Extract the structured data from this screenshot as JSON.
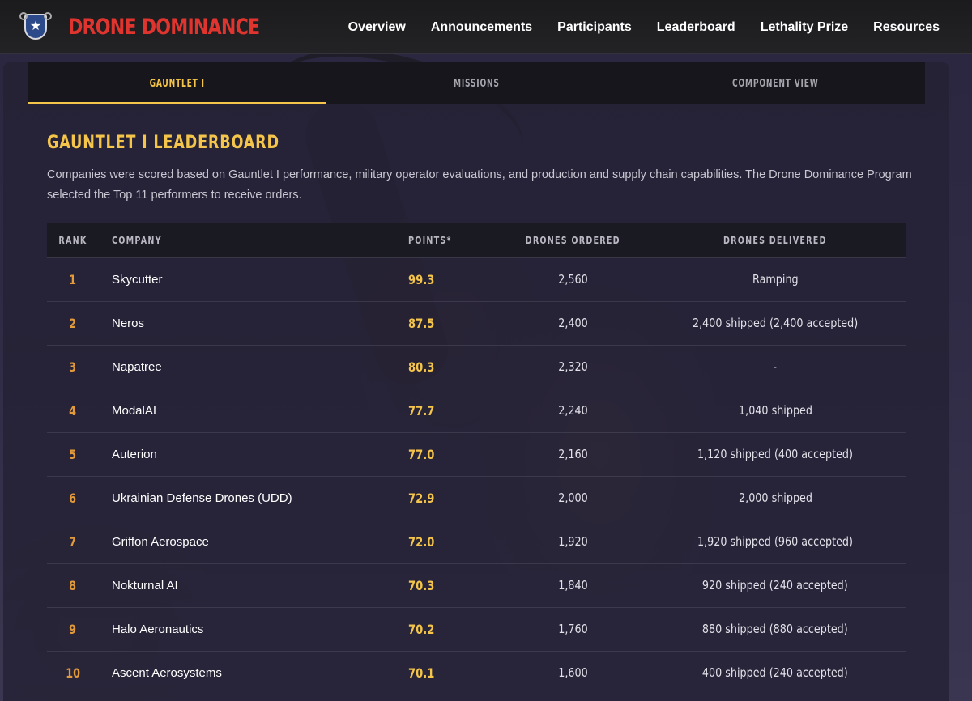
{
  "brand": {
    "name": "DRONE DOMINANCE",
    "logo_icon": "shield-star-icon"
  },
  "nav": [
    {
      "label": "Overview"
    },
    {
      "label": "Announcements"
    },
    {
      "label": "Participants"
    },
    {
      "label": "Leaderboard"
    },
    {
      "label": "Lethality Prize"
    },
    {
      "label": "Resources"
    }
  ],
  "tabs": [
    {
      "label": "GAUNTLET I",
      "active": true
    },
    {
      "label": "MISSIONS",
      "active": false
    },
    {
      "label": "COMPONENT VIEW",
      "active": false
    }
  ],
  "leaderboard": {
    "title": "GAUNTLET I LEADERBOARD",
    "description": "Companies were scored based on Gauntlet I performance, military operator evaluations, and production and supply chain capabilities. The Drone Dominance Program selected the Top 11 performers to receive orders.",
    "columns": {
      "rank": "RANK",
      "company": "COMPANY",
      "points": "POINTS*",
      "ordered": "DRONES ORDERED",
      "delivered": "DRONES DELIVERED"
    },
    "rows": [
      {
        "rank": "1",
        "company": "Skycutter",
        "points": "99.3",
        "ordered": "2,560",
        "delivered": "Ramping"
      },
      {
        "rank": "2",
        "company": "Neros",
        "points": "87.5",
        "ordered": "2,400",
        "delivered": "2,400 shipped (2,400 accepted)"
      },
      {
        "rank": "3",
        "company": "Napatree",
        "points": "80.3",
        "ordered": "2,320",
        "delivered": "-"
      },
      {
        "rank": "4",
        "company": "ModalAI",
        "points": "77.7",
        "ordered": "2,240",
        "delivered": "1,040 shipped"
      },
      {
        "rank": "5",
        "company": "Auterion",
        "points": "77.0",
        "ordered": "2,160",
        "delivered": "1,120 shipped (400 accepted)"
      },
      {
        "rank": "6",
        "company": "Ukrainian Defense Drones (UDD)",
        "points": "72.9",
        "ordered": "2,000",
        "delivered": "2,000 shipped"
      },
      {
        "rank": "7",
        "company": "Griffon Aerospace",
        "points": "72.0",
        "ordered": "1,920",
        "delivered": "1,920 shipped (960 accepted)"
      },
      {
        "rank": "8",
        "company": "Nokturnal AI",
        "points": "70.3",
        "ordered": "1,840",
        "delivered": "920 shipped (240 accepted)"
      },
      {
        "rank": "9",
        "company": "Halo Aeronautics",
        "points": "70.2",
        "ordered": "1,760",
        "delivered": "880 shipped (880 accepted)"
      },
      {
        "rank": "10",
        "company": "Ascent Aerosystems",
        "points": "70.1",
        "ordered": "1,600",
        "delivered": "400 shipped (240 accepted)"
      }
    ]
  },
  "colors": {
    "accent": "#f4c54a",
    "brand": "#e0342f",
    "rank": "#e39a3a"
  }
}
